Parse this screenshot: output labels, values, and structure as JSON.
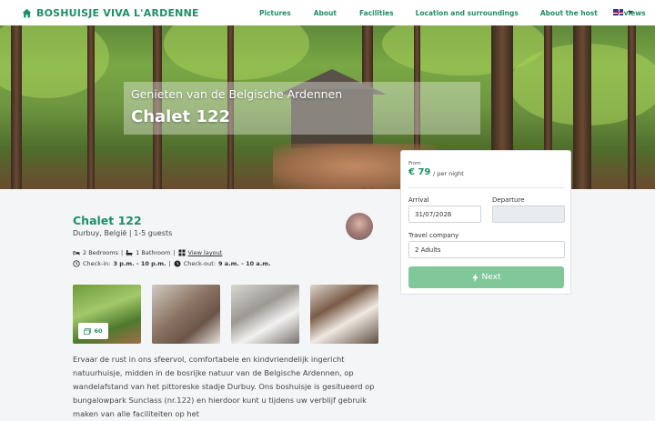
{
  "nav": {
    "brand": "BOSHUISJE VIVA L'ARDENNE",
    "links": [
      "Pictures",
      "About",
      "Facilities",
      "Location and surroundings",
      "About the host",
      "Reviews"
    ]
  },
  "hero": {
    "subtitle": "Genieten van de Belgische Ardennen",
    "title": "Chalet 122"
  },
  "booking": {
    "from_label": "From",
    "price": "€ 79",
    "per_night": "/ per night",
    "arrival_label": "Arrival",
    "arrival_value": "31/07/2026",
    "departure_label": "Departure",
    "departure_value": "",
    "company_label": "Travel company",
    "company_value": "2 Adults",
    "next_label": "Next"
  },
  "listing": {
    "title": "Chalet 122",
    "subtitle": "Durbuy, België | 1-5 guests",
    "bedrooms": "2 Bedrooms",
    "bathrooms": "1 Bathroom",
    "layout_link": "View layout",
    "checkin_label": "Check-in:",
    "checkin_value": "3 p.m. - 10 p.m.",
    "checkout_label": "Check-out:",
    "checkout_value": "9 a.m. - 10 a.m.",
    "photo_count": "60",
    "description": "Ervaar de rust in ons sfeervol, comfortabele en kindvriendelijk ingericht natuurhuisje, midden in de bosrijke natuur van de Belgische Ardennen, op wandelafstand van het pittoreske stadje Durbuy. Ons boshuisje is gesitueerd op bungalowpark Sunclass (nr.122) en hierdoor kunt u tijdens uw verblijf gebruik maken van alle faciliteiten op het"
  },
  "colors": {
    "accent": "#1e8f6a",
    "button": "#80c79a"
  }
}
